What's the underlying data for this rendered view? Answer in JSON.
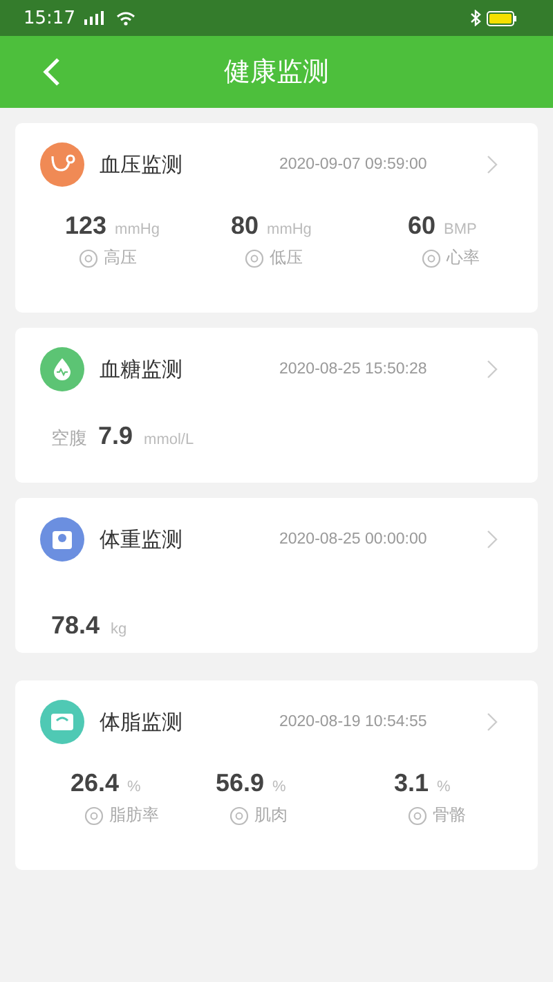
{
  "status_bar": {
    "time": "15:17"
  },
  "header": {
    "title": "健康监测"
  },
  "cards": [
    {
      "kind": "stats",
      "color": "#f08a55",
      "title": "血压监测",
      "date": "2020-09-07 09:59:00",
      "stats": [
        {
          "value": "123",
          "unit": "mmHg",
          "label": "高压"
        },
        {
          "value": "80",
          "unit": "mmHg",
          "label": "低压"
        },
        {
          "value": "60",
          "unit": "BMP",
          "label": "心率"
        }
      ]
    },
    {
      "kind": "single",
      "color": "#5cc474",
      "title": "血糖监测",
      "date": "2020-08-25 15:50:28",
      "prefix": "空腹",
      "value": "7.9",
      "unit": "mmol/L"
    },
    {
      "kind": "single",
      "color": "#6b8fe0",
      "title": "体重监测",
      "date": "2020-08-25 00:00:00",
      "value": "78.4",
      "unit": "kg"
    },
    {
      "kind": "stats",
      "color": "#4fc9b4",
      "title": "体脂监测",
      "date": "2020-08-19 10:54:55",
      "stats": [
        {
          "value": "26.4",
          "unit": "%",
          "label": "脂肪率"
        },
        {
          "value": "56.9",
          "unit": "%",
          "label": "肌肉"
        },
        {
          "value": "3.1",
          "unit": "%",
          "label": "骨骼"
        }
      ]
    }
  ]
}
